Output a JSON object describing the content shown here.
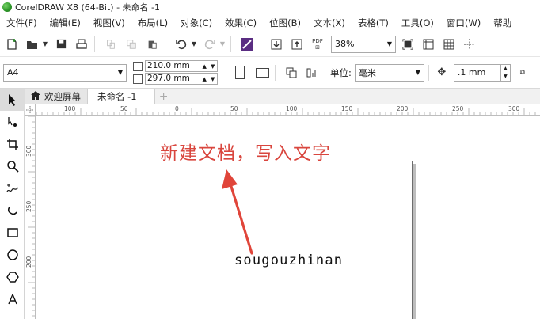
{
  "window": {
    "title": "CorelDRAW X8 (64-Bit) - 未命名 -1"
  },
  "menu": [
    "文件(F)",
    "编辑(E)",
    "视图(V)",
    "布局(L)",
    "对象(C)",
    "效果(C)",
    "位图(B)",
    "文本(X)",
    "表格(T)",
    "工具(O)",
    "窗口(W)",
    "帮助"
  ],
  "toolbar": {
    "zoom": "38%",
    "pdf_label": "PDF",
    "icons": [
      "new-icon",
      "open-icon",
      "save-icon",
      "print-icon",
      "cut-icon",
      "copy-icon",
      "paste-icon",
      "undo-icon",
      "redo-icon",
      "search-content-icon",
      "import-icon",
      "export-icon",
      "publish-pdf-icon",
      "full-screen-icon",
      "show-rulers-icon",
      "show-grid-icon",
      "show-guidelines-icon"
    ]
  },
  "property_bar": {
    "paper_size": "A4",
    "width": "210.0 mm",
    "height": "297.0 mm",
    "units_label": "单位:",
    "units": "毫米",
    "nudge": ".1 mm"
  },
  "tabs": {
    "welcome": "欢迎屏幕",
    "document": "未命名 -1",
    "add": "+"
  },
  "hruler": {
    "labels": [
      "100",
      "50",
      "0",
      "50",
      "100",
      "150",
      "200",
      "250",
      "300"
    ]
  },
  "vruler": {
    "labels": [
      "300",
      "250",
      "200"
    ]
  },
  "canvas": {
    "annotation": "新建文档，写入文字",
    "document_text": "sougouzhinan",
    "annotation_color": "#d9463e"
  }
}
